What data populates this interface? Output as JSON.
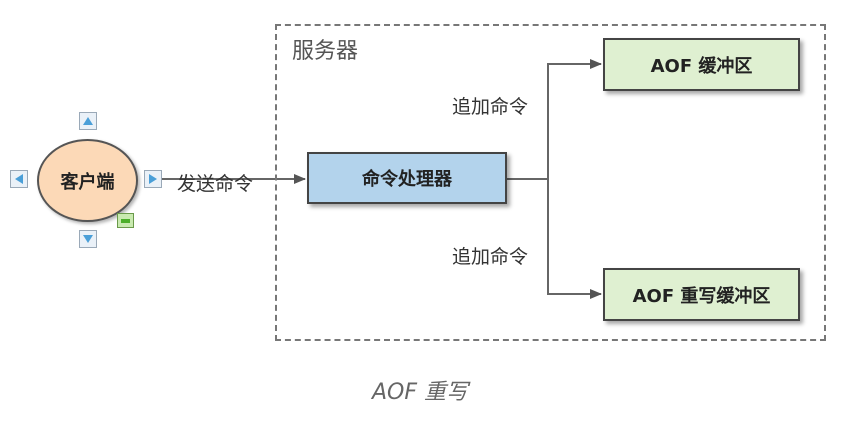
{
  "server": {
    "label": "服务器"
  },
  "client": {
    "label": "客户端"
  },
  "processor": {
    "label": "命令处理器"
  },
  "aof_buffer": {
    "label": "AOF 缓冲区"
  },
  "rewrite_buffer": {
    "label": "AOF 重写缓冲区"
  },
  "edges": {
    "send": "发送命令",
    "append_top": "追加命令",
    "append_bottom": "追加命令"
  },
  "caption": "AOF 重写",
  "colors": {
    "processor_fill": "#b3d3ec",
    "buffer_fill": "#dff0d1",
    "client_fill": "#fcd9b7"
  }
}
